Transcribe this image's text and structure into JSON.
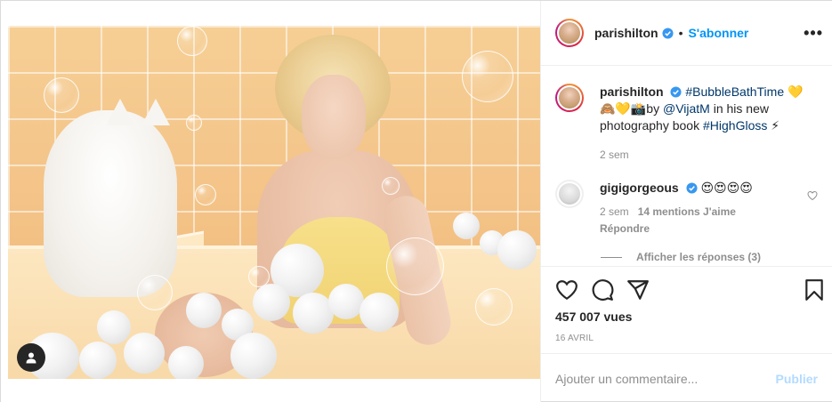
{
  "post": {
    "author": "parishilton",
    "follow_label": "S'abonner",
    "separator": "•",
    "more_label": "•••"
  },
  "caption": {
    "username": "parishilton",
    "hashtag1": "#BubbleBathTime",
    "emoji1": "💛",
    "emoji2": "🙈💛📸",
    "text_by": "by ",
    "mention": "@VijatM",
    "text_rest": " in his new photography book ",
    "hashtag2": "#HighGloss",
    "emoji3": "⚡",
    "time": "2 sem"
  },
  "comment": {
    "username": "gigigorgeous",
    "text": "😍😍😍😍",
    "time": "2 sem",
    "likes": "14 mentions J'aime",
    "reply": "Répondre",
    "view_replies": "Afficher les réponses (3)"
  },
  "stats": {
    "views": "457 007 vues",
    "date": "16 AVRIL"
  },
  "composer": {
    "placeholder": "Ajouter un commentaire...",
    "publish": "Publier"
  },
  "colors": {
    "accent": "#0095f6",
    "verified": "#3897f0",
    "link": "#00376b",
    "muted": "#8e8e8e"
  },
  "icons": [
    "user-tag-icon",
    "verified-icon",
    "more-icon",
    "heart-icon",
    "comment-icon",
    "share-icon",
    "bookmark-icon",
    "small-heart-icon"
  ]
}
